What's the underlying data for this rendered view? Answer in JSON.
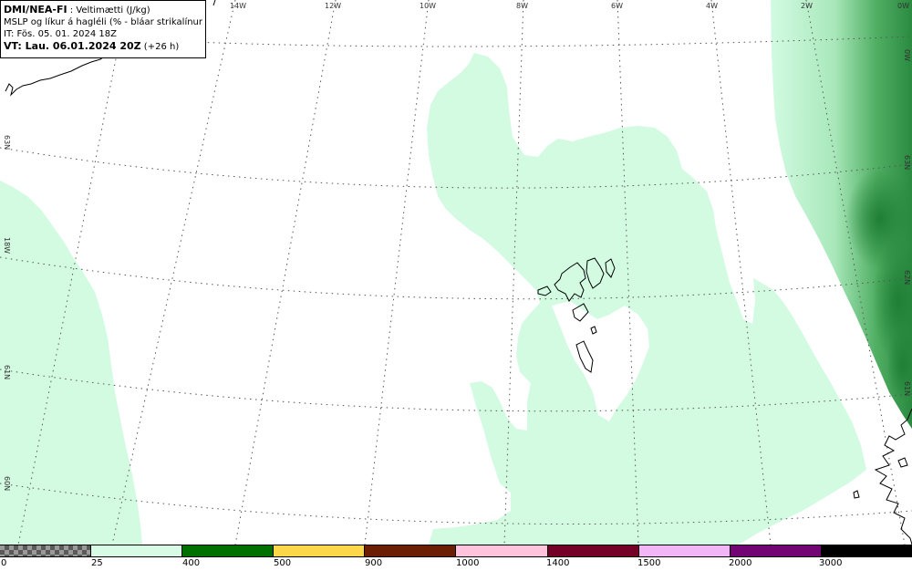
{
  "header": {
    "model": "DMI/NEA-FI",
    "variable": " : Veltimætti (J/kg)",
    "subtitle": "MSLP og líkur á hagléli (% - bláar strikalínur)",
    "initial_time": "IT: Fös. 05. 01. 2024 18Z",
    "valid_prefix": "VT: Lau. 06.01.2024 20Z",
    "valid_suffix": " (+26 h)"
  },
  "grid": {
    "lon_labels": [
      "14W",
      "12W",
      "10W",
      "8W",
      "6W",
      "4W",
      "2W",
      "0W"
    ],
    "lat_labels_left": [
      "63N",
      "18W",
      "61N",
      "60N"
    ],
    "lat_labels_right": [
      "0W",
      "63N",
      "62N",
      "61N"
    ]
  },
  "legend": {
    "colors": [
      "checker",
      "#d8fbe6",
      "#007000",
      "#fdd74a",
      "#6b1e04",
      "#ffc4dc",
      "#750028",
      "#f2b6f6",
      "#720474",
      "#000000"
    ],
    "labels": [
      "0",
      "25",
      "400",
      "500",
      "900",
      "1000",
      "1400",
      "1500",
      "2000",
      "3000"
    ]
  },
  "colors": {
    "cape_low": "#d2fbe2",
    "cape_mid": "#7fcf8f",
    "cape_high": "#1f8a3a",
    "coast": "#000000",
    "grid": "#555555"
  }
}
